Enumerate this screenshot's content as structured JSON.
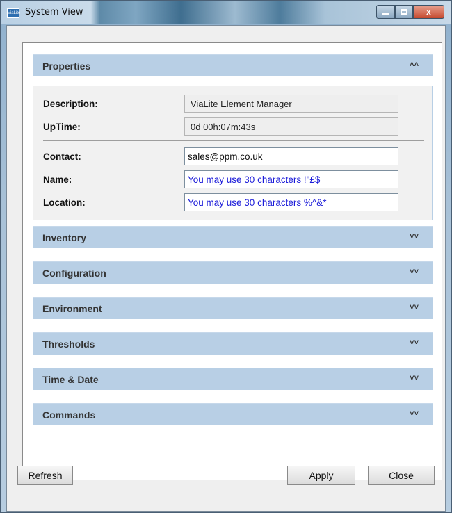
{
  "window": {
    "title": "System View",
    "icon_label": "ViaLite",
    "controls": {
      "minimize_icon": "minimize-icon",
      "maximize_icon": "maximize-icon",
      "close_glyph": "x"
    }
  },
  "sections": [
    {
      "label": "Properties",
      "expanded": true,
      "chevron": "˄˄"
    },
    {
      "label": "Inventory",
      "expanded": false,
      "chevron": "˅˅"
    },
    {
      "label": "Configuration",
      "expanded": false,
      "chevron": "˅˅"
    },
    {
      "label": "Environment",
      "expanded": false,
      "chevron": "˅˅"
    },
    {
      "label": "Thresholds",
      "expanded": false,
      "chevron": "˅˅"
    },
    {
      "label": "Time & Date",
      "expanded": false,
      "chevron": "˅˅"
    },
    {
      "label": "Commands",
      "expanded": false,
      "chevron": "˅˅"
    }
  ],
  "properties": {
    "description": {
      "label": "Description:",
      "value": "ViaLite Element Manager"
    },
    "uptime": {
      "label": "UpTime:",
      "value": "0d 00h:07m:43s"
    },
    "contact": {
      "label": "Contact:",
      "value": "sales@ppm.co.uk"
    },
    "name": {
      "label": "Name:",
      "value": "You may use 30 characters !\"£$"
    },
    "location": {
      "label": "Location:",
      "value": "You may use 30 characters %^&*"
    }
  },
  "buttons": {
    "refresh": "Refresh",
    "apply": "Apply",
    "close": "Close"
  },
  "colors": {
    "section_header_bg": "#b8cfe5",
    "input_text": "#1a1ad9"
  }
}
